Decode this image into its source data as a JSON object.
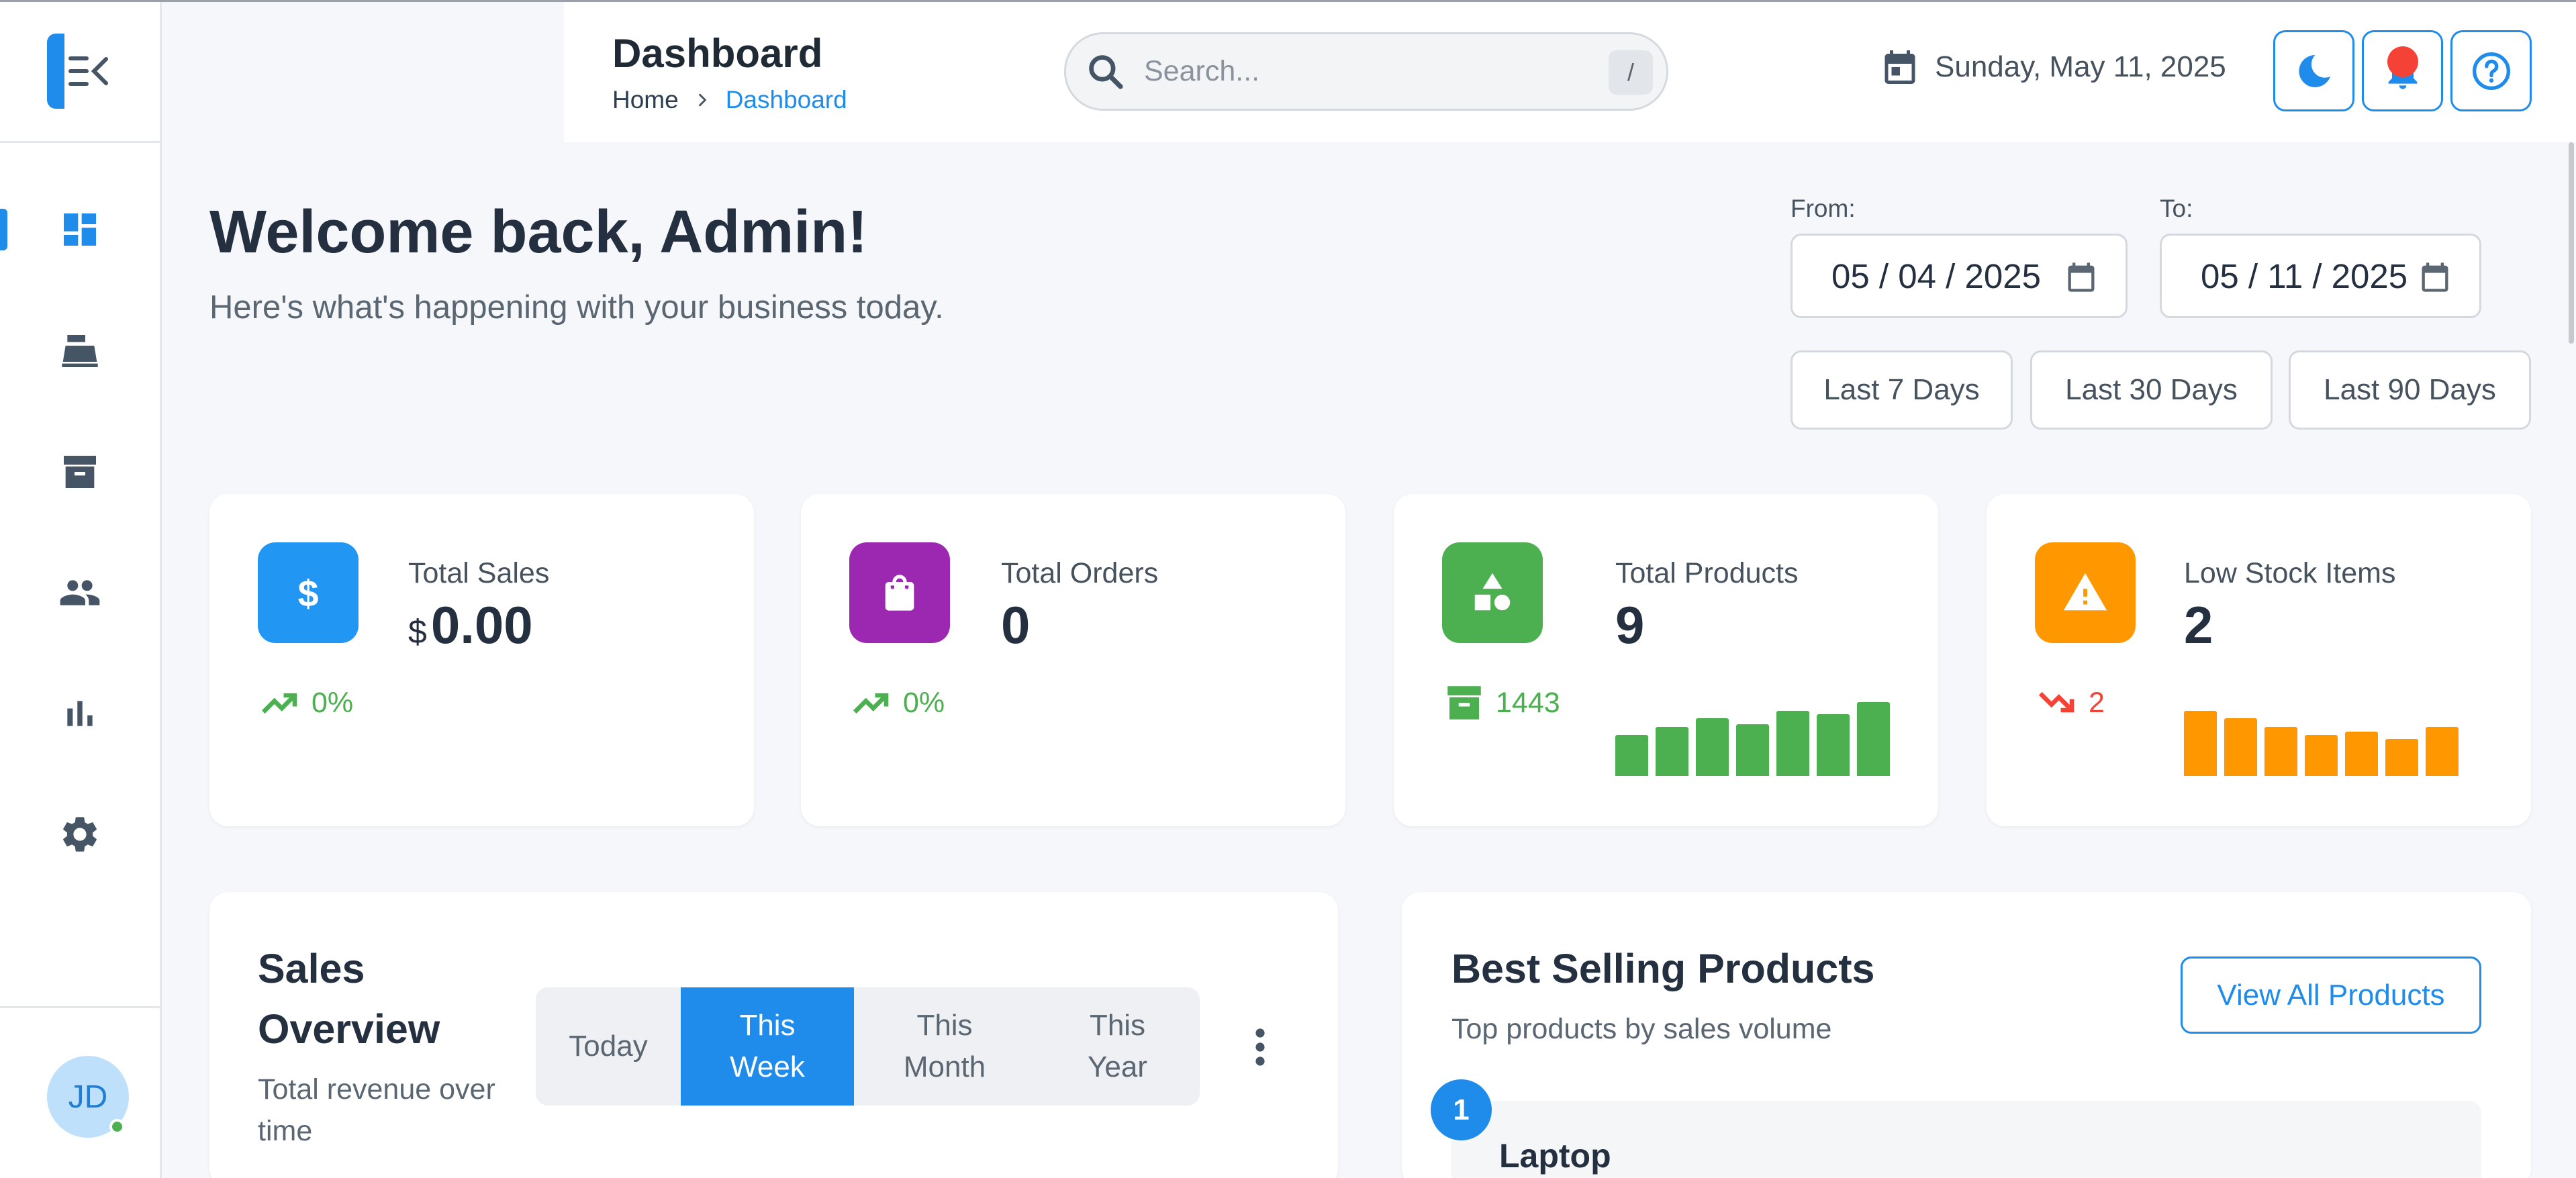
{
  "header": {
    "title": "Dashboard",
    "breadcrumb": {
      "home": "Home",
      "current": "Dashboard"
    },
    "search": {
      "placeholder": "Search...",
      "shortcut": "/"
    },
    "date": "Sunday, May 11, 2025",
    "buttons": {
      "theme": "moon-icon",
      "notifications": "bell-icon",
      "help": "help-icon"
    }
  },
  "sidebar": {
    "items": [
      {
        "icon": "dashboard-icon",
        "active": true
      },
      {
        "icon": "cash-register-icon",
        "active": false
      },
      {
        "icon": "archive-icon",
        "active": false
      },
      {
        "icon": "users-icon",
        "active": false
      },
      {
        "icon": "bar-chart-icon",
        "active": false
      },
      {
        "icon": "gear-icon",
        "active": false
      }
    ],
    "user_initials": "JD"
  },
  "welcome": {
    "title": "Welcome back, Admin!",
    "subtitle": "Here's what's happening with your business today."
  },
  "date_range": {
    "from_label": "From:",
    "from_value": "05 / 04 / 2025",
    "to_label": "To:",
    "to_value": "05 / 11 / 2025",
    "quick": [
      "Last 7 Days",
      "Last 30 Days",
      "Last 90 Days"
    ]
  },
  "stats": [
    {
      "title": "Total Sales",
      "currency": "$",
      "value": "0.00",
      "trend": "0%",
      "trend_dir": "up",
      "color": "#2196f3",
      "icon": "dollar-icon"
    },
    {
      "title": "Total Orders",
      "value": "0",
      "trend": "0%",
      "trend_dir": "up",
      "color": "#9c27b0",
      "icon": "shopping-bag-icon"
    },
    {
      "title": "Total Products",
      "value": "9",
      "sub": "1443",
      "color": "#4caf50",
      "icon": "shapes-icon",
      "spark": [
        0.55,
        0.66,
        0.78,
        0.7,
        0.88,
        0.84,
        1.0
      ]
    },
    {
      "title": "Low Stock Items",
      "value": "2",
      "sub": "2",
      "trend_dir": "down",
      "color": "#ff9800",
      "icon": "warning-icon",
      "spark": [
        0.88,
        0.78,
        0.66,
        0.55,
        0.6,
        0.5,
        0.66
      ]
    }
  ],
  "sales_overview": {
    "title": "Sales Overview",
    "subtitle": "Total revenue over time",
    "tabs": [
      {
        "label": "Today",
        "active": false
      },
      {
        "label": "This Week",
        "active": true
      },
      {
        "label": "This Month",
        "active": false
      },
      {
        "label": "This Year",
        "active": false
      }
    ]
  },
  "best_selling": {
    "title": "Best Selling Products",
    "subtitle": "Top products by sales volume",
    "view_all": "View All Products",
    "items": [
      {
        "rank": "1",
        "name": "Laptop"
      }
    ]
  }
}
